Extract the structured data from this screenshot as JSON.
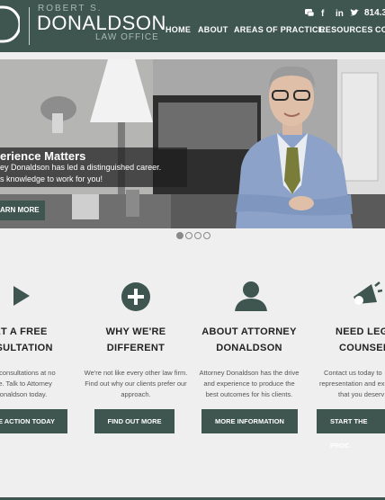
{
  "header": {
    "logo_top": "ROBERT S.",
    "logo_name": "DONALDSON",
    "logo_tag": "LAW OFFICE",
    "phone": "814.31",
    "social_icons": [
      "chat-icon",
      "facebook-icon",
      "linkedin-icon",
      "twitter-icon"
    ]
  },
  "nav": {
    "items": [
      "HOME",
      "ABOUT",
      "AREAS OF PRACTICE",
      "RESOURCES",
      "CO"
    ]
  },
  "hero": {
    "title": "erience Matters",
    "line1": "ey Donaldson has led a distinguished career.",
    "line2": "s knowledge to work for you!",
    "button": "ARN MORE",
    "slide_count": 4,
    "active_slide": 1
  },
  "features": [
    {
      "icon": "play-icon",
      "title1": "ET A FREE",
      "title2": "NSULTATION",
      "text1": "er consultations at no",
      "text2": "ge. Talk to Attorney",
      "text3": "onaldson today.",
      "button": "E ACTION TODAY"
    },
    {
      "icon": "plus-icon",
      "title1": "WHY WE'RE",
      "title2": "DIFFERENT",
      "text1": "We're not like every other law firm.",
      "text2": "Find out why our clients prefer our",
      "text3": "approach.",
      "button": "FIND OUT MORE"
    },
    {
      "icon": "user-icon",
      "title1": "ABOUT ATTORNEY",
      "title2": "DONALDSON",
      "text1": "Attorney Donaldson has the drive",
      "text2": "and experience to produce the",
      "text3": "best outcomes for his clients.",
      "button": "MORE INFORMATION"
    },
    {
      "icon": "megaphone-icon",
      "title1": "NEED LEGA",
      "title2": "COUNSEL",
      "text1": "Contact us today to",
      "text2": "representation and ex",
      "text3": "that you deserv",
      "button": "START THE PROC"
    }
  ],
  "colors": {
    "brand": "#3f5650",
    "background": "#efefef",
    "text": "#222222"
  }
}
